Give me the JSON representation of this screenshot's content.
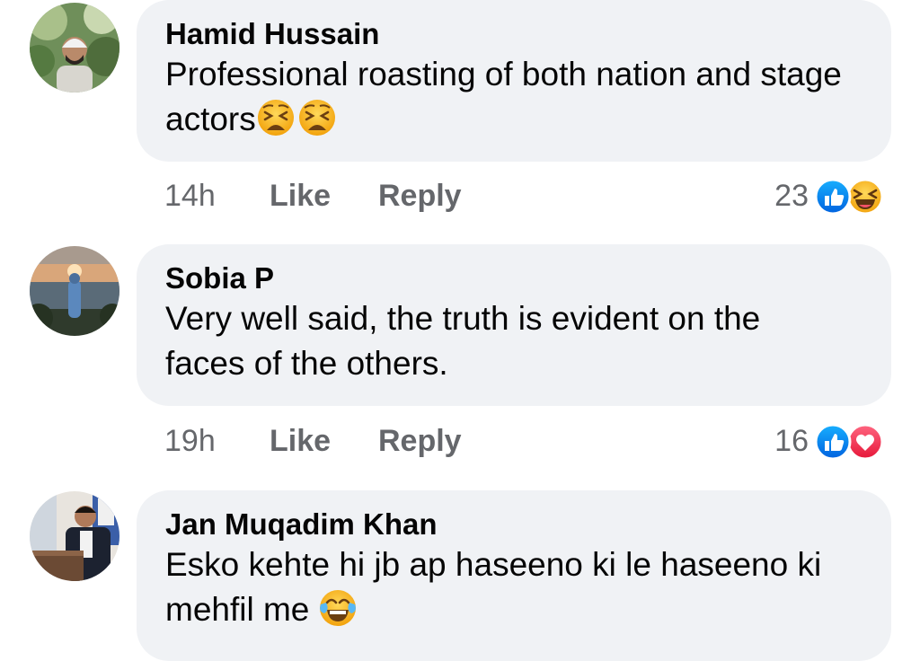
{
  "comments": [
    {
      "author": "Hamid Hussain",
      "text": "Professional roasting of both nation and stage actors",
      "emojis": [
        "weary-face",
        "weary-face"
      ],
      "time": "14h",
      "like_label": "Like",
      "reply_label": "Reply",
      "reaction_count": "23",
      "reactions": [
        "like-reaction",
        "haha-reaction"
      ]
    },
    {
      "author": "Sobia P",
      "text": "Very well said, the truth is evident on the faces of the others.",
      "emojis": [],
      "time": "19h",
      "like_label": "Like",
      "reply_label": "Reply",
      "reaction_count": "16",
      "reactions": [
        "like-reaction",
        "love-reaction"
      ]
    },
    {
      "author": "Jan Muqadim Khan",
      "text": "Esko kehte hi jb ap haseeno ki le haseeno ki mehfil me",
      "emojis": [
        "tears-of-joy"
      ]
    }
  ],
  "colors": {
    "bubble": "#f0f2f5",
    "meta_text": "#65676b",
    "like_blue": "#1877f2",
    "love_red": "#f33e58",
    "emoji_yellow": "#f7b125"
  }
}
